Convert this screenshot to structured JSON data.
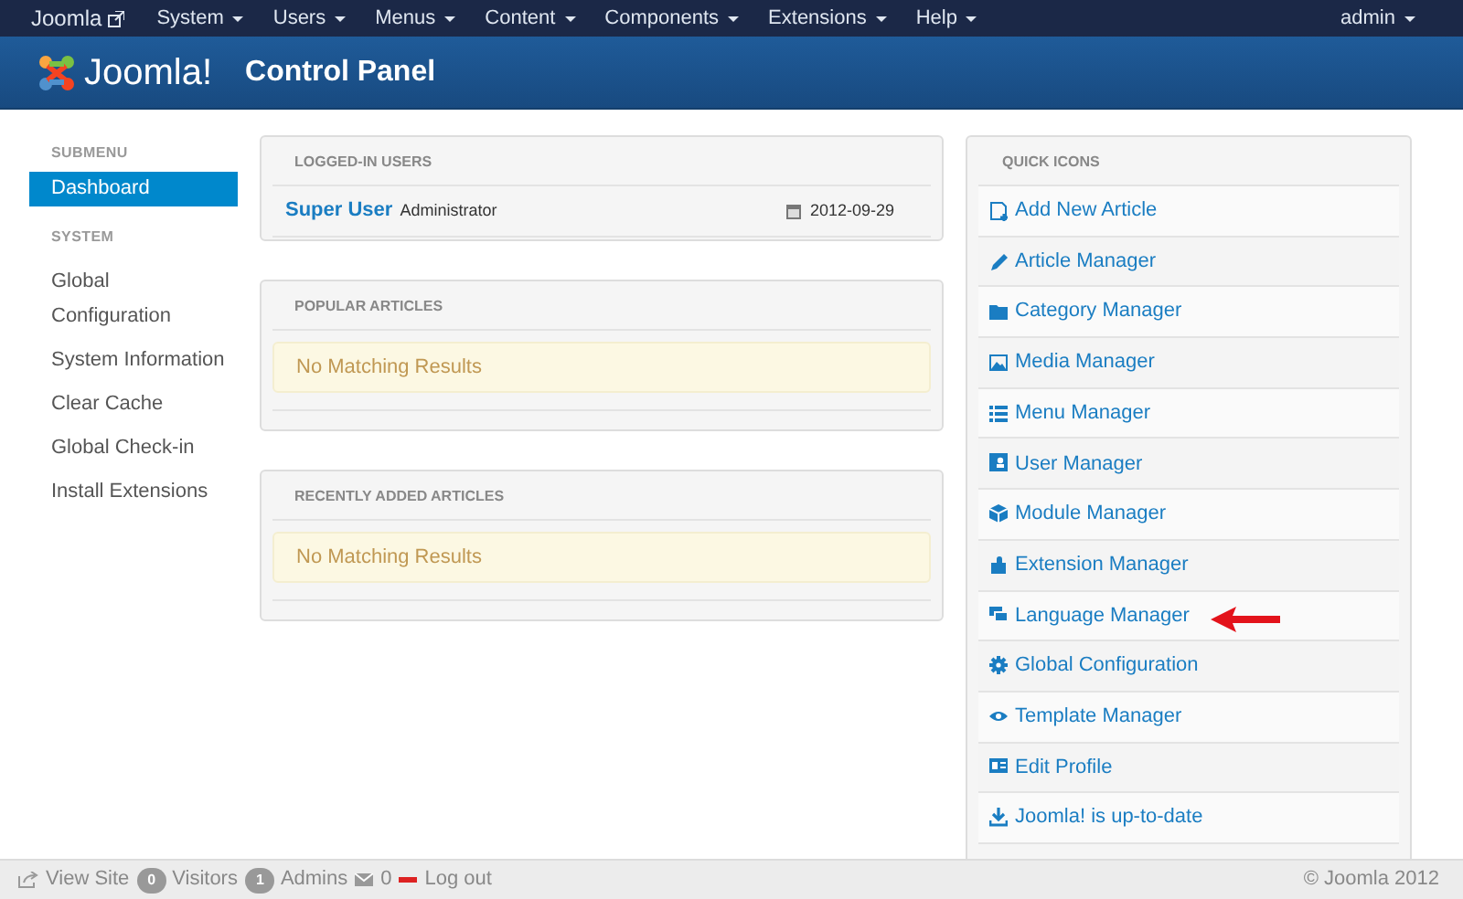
{
  "top_menu": {
    "brand": "Joomla",
    "items": [
      "System",
      "Users",
      "Menus",
      "Content",
      "Components",
      "Extensions",
      "Help"
    ],
    "user": "admin"
  },
  "header": {
    "logo": "Joomla!",
    "title": "Control Panel"
  },
  "sidebar": {
    "sections": [
      {
        "heading": "SUBMENU",
        "items": [
          {
            "label": "Dashboard",
            "selected": true
          }
        ]
      },
      {
        "heading": "SYSTEM",
        "items": [
          {
            "label": "Global Configuration",
            "selected": false
          },
          {
            "label": "System Information",
            "selected": false
          },
          {
            "label": "Clear Cache",
            "selected": false
          },
          {
            "label": "Global Check-in",
            "selected": false
          },
          {
            "label": "Install Extensions",
            "selected": false
          }
        ]
      }
    ]
  },
  "logged_in_users": {
    "heading": "LOGGED-IN USERS",
    "rows": [
      {
        "name": "Super User",
        "role": "Administrator",
        "date": "2012-09-29"
      }
    ]
  },
  "popular_articles": {
    "heading": "POPULAR ARTICLES",
    "message": "No Matching Results"
  },
  "recently_added_articles": {
    "heading": "RECENTLY ADDED ARTICLES",
    "message": "No Matching Results"
  },
  "quick_icons": {
    "heading": "QUICK ICONS",
    "items": [
      {
        "label": "Add New Article",
        "highlighted": false
      },
      {
        "label": "Article Manager",
        "highlighted": false
      },
      {
        "label": "Category Manager",
        "highlighted": false
      },
      {
        "label": "Media Manager",
        "highlighted": false
      },
      {
        "label": "Menu Manager",
        "highlighted": false
      },
      {
        "label": "User Manager",
        "highlighted": false
      },
      {
        "label": "Module Manager",
        "highlighted": false
      },
      {
        "label": "Extension Manager",
        "highlighted": false
      },
      {
        "label": "Language Manager",
        "highlighted": true
      },
      {
        "label": "Global Configuration",
        "highlighted": false
      },
      {
        "label": "Template Manager",
        "highlighted": false
      },
      {
        "label": "Edit Profile",
        "highlighted": false
      },
      {
        "label": "Joomla! is up-to-date",
        "highlighted": false
      }
    ]
  },
  "status_bar": {
    "view_site": "View Site",
    "visitors_count": "0",
    "visitors": "Visitors",
    "admins_count": "1",
    "admins": "Admins",
    "messages": "0",
    "logout": "Log out",
    "copyright": "© Joomla 2012"
  }
}
